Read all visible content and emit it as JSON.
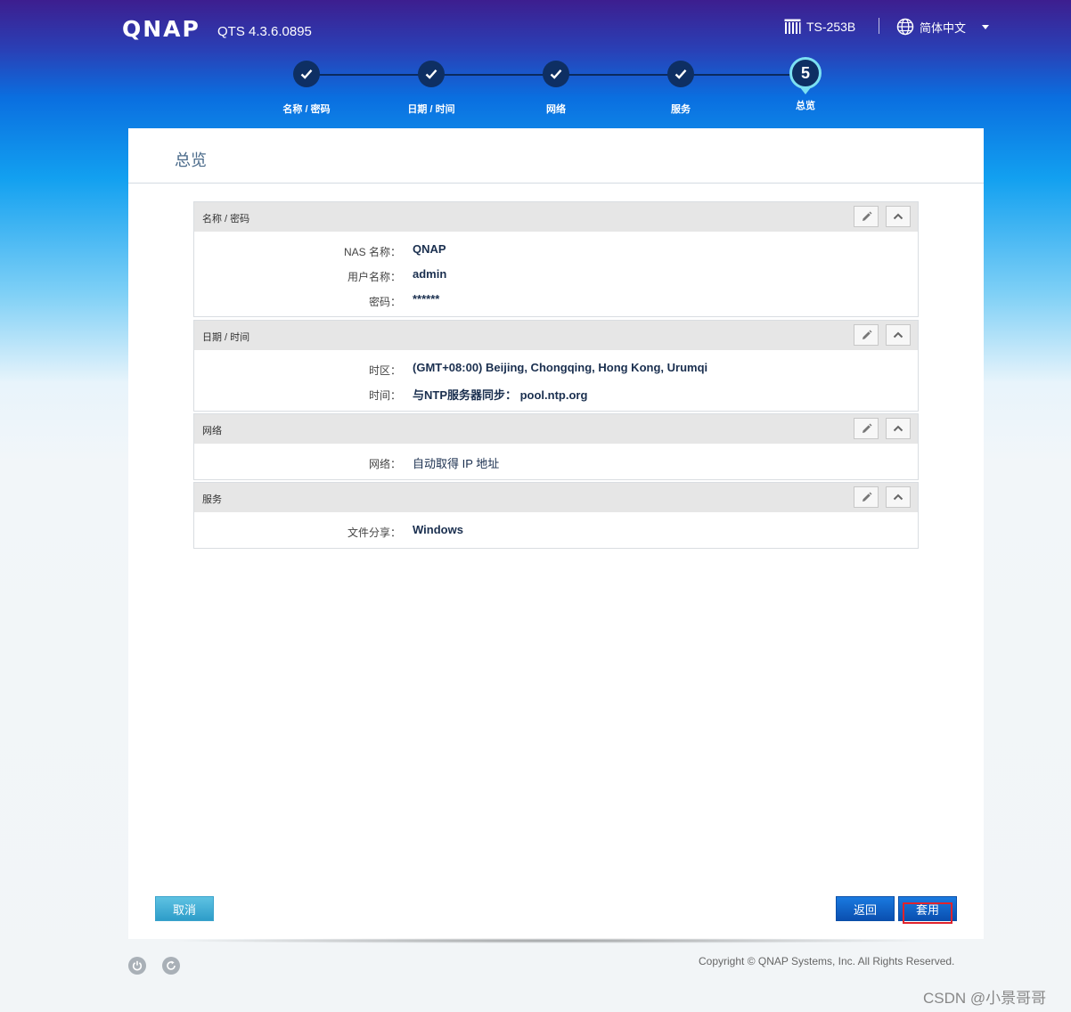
{
  "header": {
    "logo": "QNAP",
    "version": "QTS 4.3.6.0895",
    "model": "TS-253B",
    "language": "简体中文"
  },
  "steps": [
    {
      "label": "名称 / 密码",
      "state": "done"
    },
    {
      "label": "日期 / 时间",
      "state": "done"
    },
    {
      "label": "网络",
      "state": "done"
    },
    {
      "label": "服务",
      "state": "done"
    },
    {
      "label": "总览",
      "state": "current",
      "number": "5"
    }
  ],
  "panel": {
    "title": "总览",
    "sections": [
      {
        "title": "名称 / 密码",
        "rows": [
          {
            "label": "NAS 名称：",
            "value": "QNAP"
          },
          {
            "label": "用户名称：",
            "value": "admin"
          },
          {
            "label": "密码：",
            "value": "******"
          }
        ]
      },
      {
        "title": "日期 / 时间",
        "rows": [
          {
            "label": "时区：",
            "value": "(GMT+08:00) Beijing, Chongqing, Hong Kong, Urumqi"
          },
          {
            "label": "时间：",
            "value": "与NTP服务器同步： pool.ntp.org"
          }
        ]
      },
      {
        "title": "网络",
        "rows": [
          {
            "label": "网络：",
            "value": "自动取得 IP 地址"
          }
        ]
      },
      {
        "title": "服务",
        "rows": [
          {
            "label": "文件分享：",
            "value": "Windows"
          }
        ]
      }
    ]
  },
  "buttons": {
    "cancel": "取消",
    "back": "返回",
    "apply": "套用"
  },
  "footer": {
    "copyright": "Copyright © QNAP Systems, Inc. All Rights Reserved.",
    "watermark": "CSDN @小景哥哥"
  },
  "colors": {
    "accent": "#0a4fb0",
    "step_done": "#0e2f63",
    "step_current_ring": "#7be0f2",
    "highlight": "#e0232c"
  }
}
